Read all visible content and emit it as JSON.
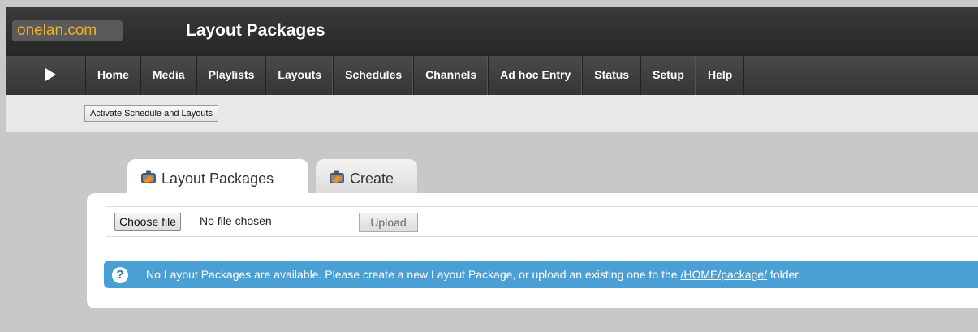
{
  "header": {
    "brand": "onelan.com",
    "title": "Layout Packages"
  },
  "nav": {
    "play_icon": "play-icon",
    "items": [
      "Home",
      "Media",
      "Playlists",
      "Layouts",
      "Schedules",
      "Channels",
      "Ad hoc Entry",
      "Status",
      "Setup",
      "Help"
    ]
  },
  "toolbar": {
    "activate_label": "Activate Schedule and Layouts"
  },
  "tabs": [
    {
      "label": "Layout Packages",
      "icon": "package-icon",
      "active": true
    },
    {
      "label": "Create",
      "icon": "package-icon",
      "active": false
    }
  ],
  "upload": {
    "choose_label": "Choose file",
    "file_status": "No file chosen",
    "upload_label": "Upload"
  },
  "info": {
    "icon": "question-icon",
    "text_before": "No Layout Packages are available. Please create a new Layout Package, or upload an existing one to the ",
    "link": "/HOME/package/",
    "text_after": " folder."
  },
  "colors": {
    "brand_text": "#f0b020",
    "info_bg": "#4a9fd5"
  }
}
